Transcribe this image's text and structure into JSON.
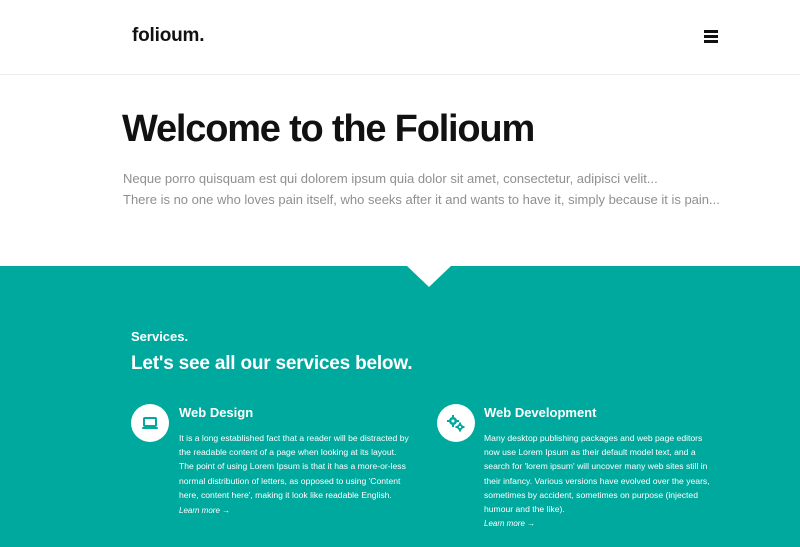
{
  "header": {
    "logo": "folioum.",
    "menu_icon": "hamburger-icon"
  },
  "hero": {
    "title": "Welcome to the Folioum",
    "lines": [
      "Neque porro quisquam est qui dolorem ipsum quia dolor sit amet, consectetur, adipisci velit...",
      "There is no one who loves pain itself, who seeks after it and wants to have it, simply because it is pain..."
    ]
  },
  "services": {
    "kicker": "Services.",
    "heading": "Let's see all our services below.",
    "background_color": "#00a99d",
    "items": [
      {
        "icon": "laptop-icon",
        "title": "Web Design",
        "lines": [
          "It is a long established fact that a reader will be distracted by",
          "the readable content of a page when looking at its layout.",
          "The point of using Lorem Ipsum is that it has a more-or-less",
          "normal distribution of letters, as opposed to using 'Content",
          "here, content here', making it look like readable English."
        ],
        "link": "Learn more →"
      },
      {
        "icon": "gears-icon",
        "title": "Web Development",
        "lines": [
          "Many desktop publishing packages and web page editors",
          "now use Lorem Ipsum as their default model text, and a",
          "search for 'lorem ipsum' will uncover many web sites still in",
          "their infancy. Various versions have evolved over the years,",
          "sometimes by accident, sometimes on purpose (injected",
          "humour and the like)."
        ],
        "link": "Learn more →"
      }
    ]
  }
}
